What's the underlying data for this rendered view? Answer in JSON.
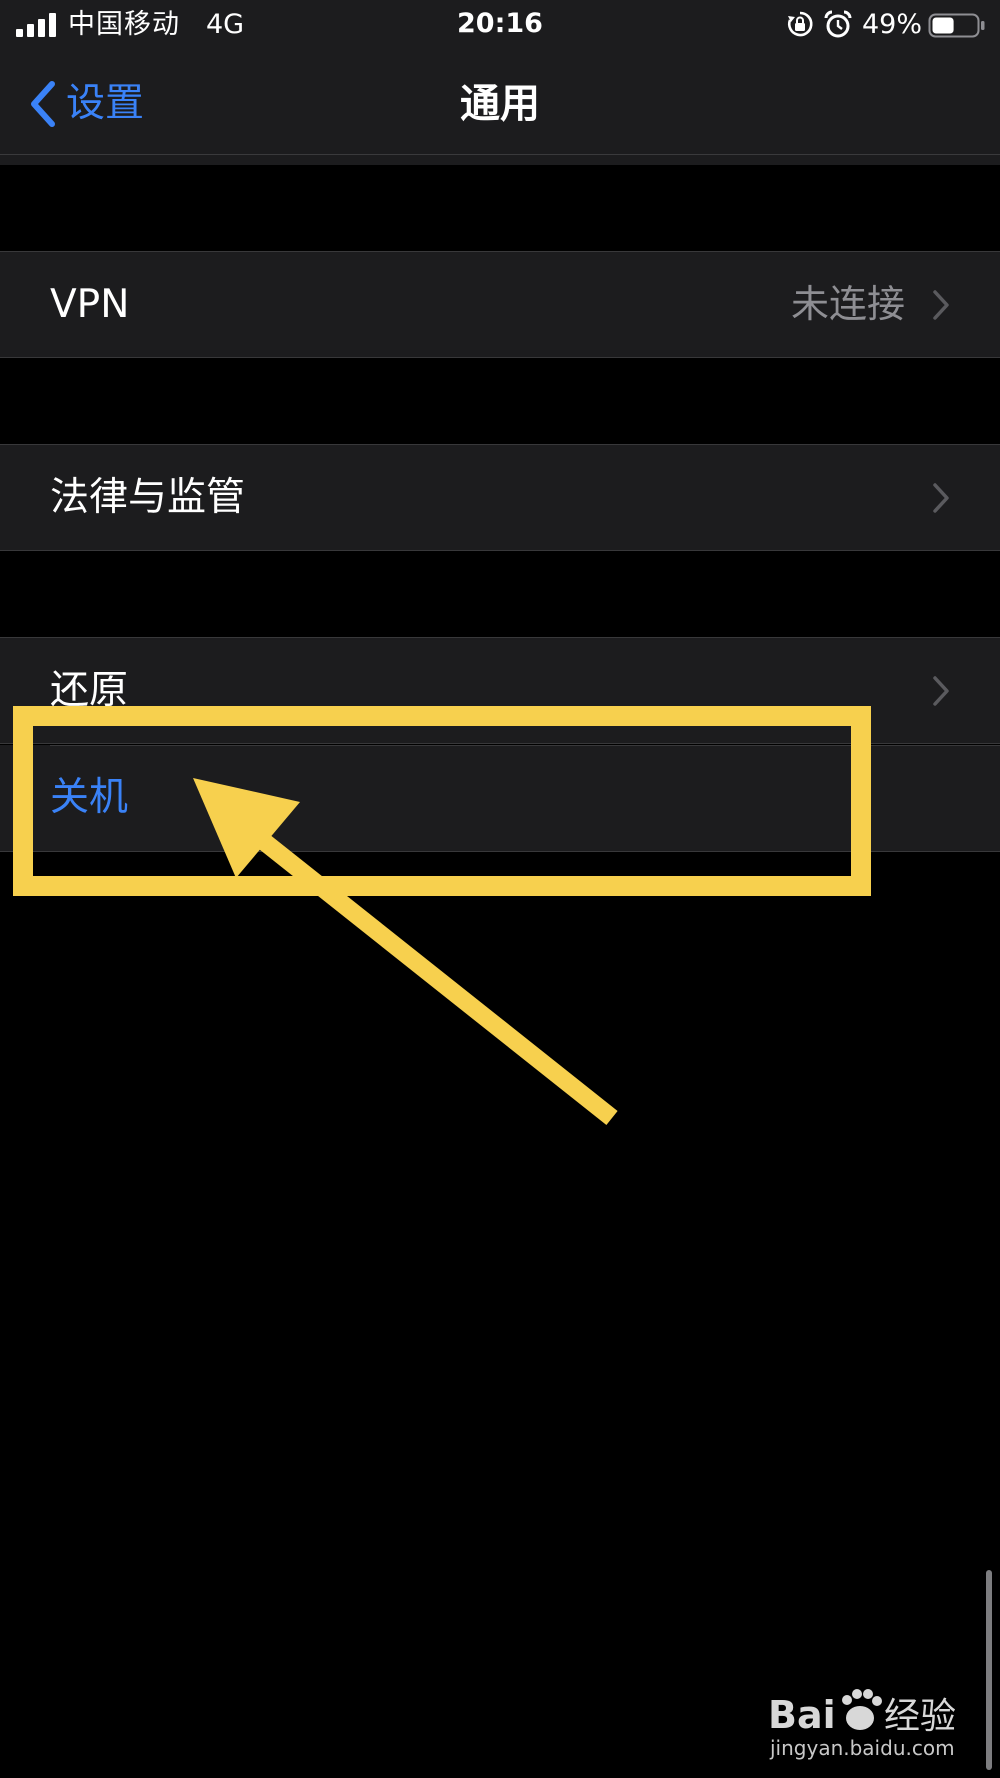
{
  "status_bar": {
    "carrier": "中国移动",
    "network": "4G",
    "time": "20:16",
    "battery_percent": "49%",
    "battery_level": 0.49,
    "icons": [
      "signal-bars-icon",
      "rotation-lock-icon",
      "alarm-icon",
      "battery-icon"
    ]
  },
  "nav": {
    "back_label": "设置",
    "title": "通用"
  },
  "cells": {
    "vpn": {
      "label": "VPN",
      "value": "未连接"
    },
    "legal": {
      "label": "法律与监管"
    },
    "reset": {
      "label": "还原"
    },
    "shutdown": {
      "label": "关机"
    }
  },
  "annotation": {
    "color": "#f7d04e",
    "shapes": [
      "highlight-box",
      "arrow"
    ]
  },
  "watermark": {
    "url": "jingyan.baidu.com"
  },
  "colors": {
    "accent_blue": "#3a82f7",
    "cell_bg": "#1c1c1e",
    "secondary_text": "#8e8e93"
  }
}
